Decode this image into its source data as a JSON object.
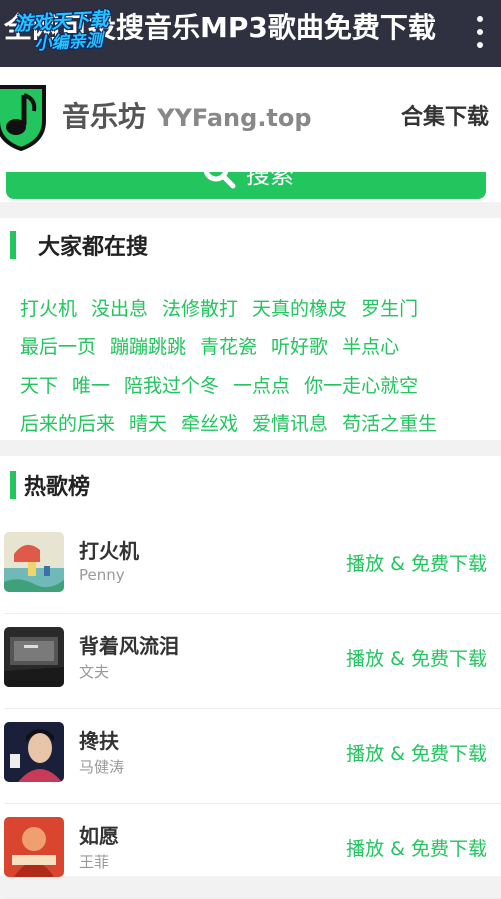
{
  "appbar": {
    "title": "全网可投搜音乐MP3歌曲免费下载",
    "watermark_line1": "游戏天下载",
    "watermark_line2": "小编亲测",
    "menu_icon": "more-vertical-icon"
  },
  "header": {
    "logo_icon": "music-note-shield-icon",
    "brand_name": "音乐坊",
    "brand_domain": "YYFang.top",
    "collection_link": "合集下载"
  },
  "search": {
    "button_label": "搜索",
    "icon": "search-icon"
  },
  "hot_search": {
    "title": "大家都在搜",
    "rows": [
      [
        "打火机",
        "没出息",
        "法修散打",
        "天真的橡皮",
        "罗生门"
      ],
      [
        "最后一页",
        "蹦蹦跳跳",
        "青花瓷",
        "听好歌",
        "半点心"
      ],
      [
        "天下",
        "唯一",
        "陪我过个冬",
        "一点点",
        "你一走心就空"
      ],
      [
        "后来的后来",
        "晴天",
        "牵丝戏",
        "爱情讯息",
        "苟活之重生"
      ]
    ]
  },
  "chart": {
    "title": "热歌榜",
    "songs": [
      {
        "title": "打火机",
        "artist": "Penny",
        "action": "播放 & 免费下载"
      },
      {
        "title": "背着风流泪",
        "artist": "文夫",
        "action": "播放 & 免费下载"
      },
      {
        "title": "搀扶",
        "artist": "马健涛",
        "action": "播放 & 免费下载"
      },
      {
        "title": "如愿",
        "artist": "王菲",
        "action": "播放 & 免费下载"
      }
    ]
  },
  "colors": {
    "accent": "#22c55e",
    "appbar_bg": "#2f3040"
  }
}
